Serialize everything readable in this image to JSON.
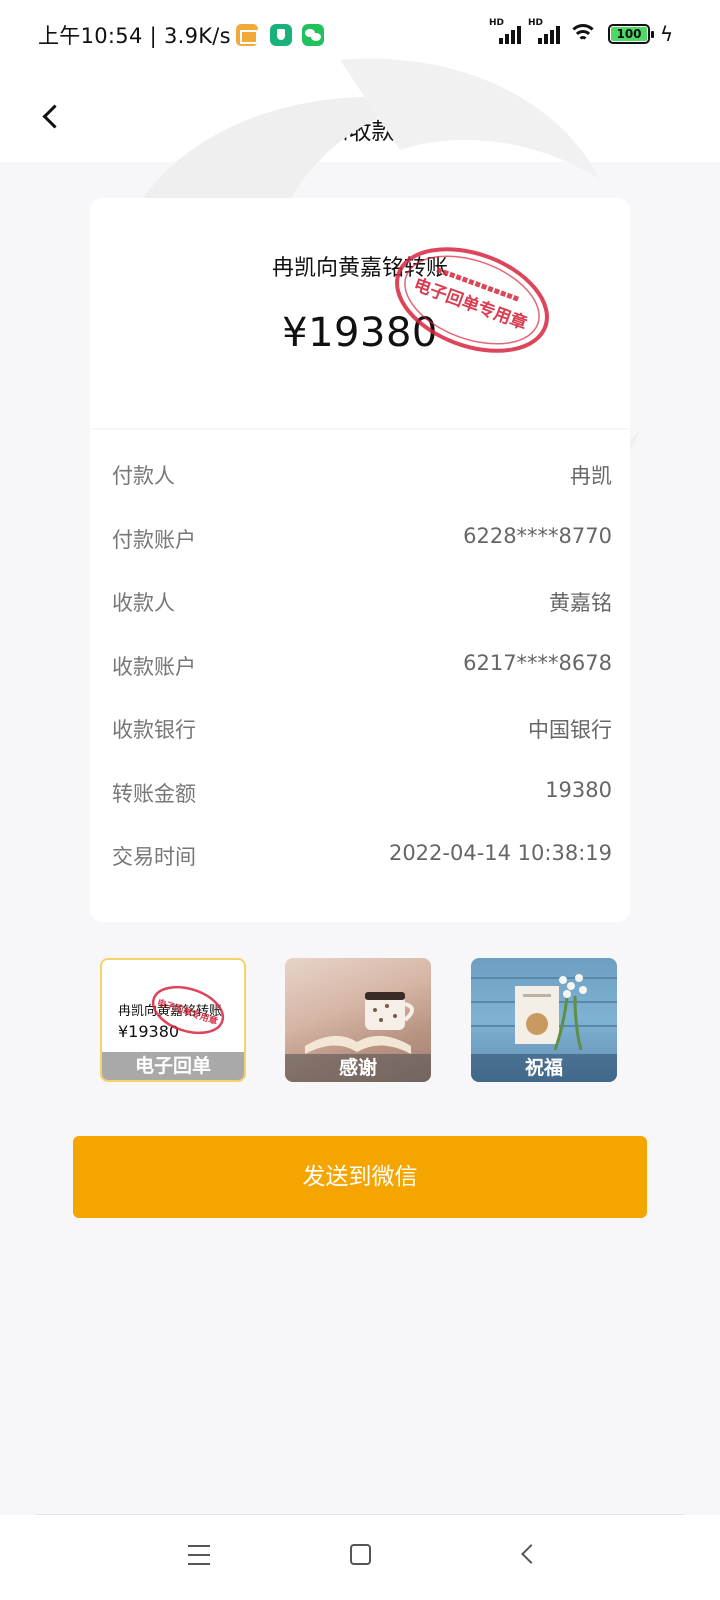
{
  "status_bar": {
    "time_speed": "上午10:54 | 3.9K/s",
    "signal_1": "HD",
    "signal_2": "HD",
    "battery": "100"
  },
  "nav": {
    "title": "通知收款人"
  },
  "receipt": {
    "transfer_title": "冉凯向黄嘉铭转账",
    "amount": "¥19380",
    "stamp_text": "电子回单专用章",
    "stamp_color": "#d7263d",
    "rows": [
      {
        "label": "付款人",
        "value": "冉凯"
      },
      {
        "label": "付款账户",
        "value": "6228****8770"
      },
      {
        "label": "收款人",
        "value": "黄嘉铭"
      },
      {
        "label": "收款账户",
        "value": "6217****8678"
      },
      {
        "label": "收款银行",
        "value": "中国银行"
      },
      {
        "label": "转账金额",
        "value": "19380"
      },
      {
        "label": "交易时间",
        "value": "2022-04-14 10:38:19"
      }
    ]
  },
  "templates": {
    "mini_title": "冉凯向黄嘉铭转账",
    "mini_amount": "¥19380",
    "items": [
      {
        "label": "电子回单"
      },
      {
        "label": "感谢"
      },
      {
        "label": "祝福"
      }
    ]
  },
  "actions": {
    "send_label": "发送到微信",
    "accent": "#f5a500"
  },
  "icons": [
    "back-icon",
    "menu-icon",
    "home-icon",
    "system-back-icon",
    "wifi-icon",
    "battery-icon"
  ]
}
